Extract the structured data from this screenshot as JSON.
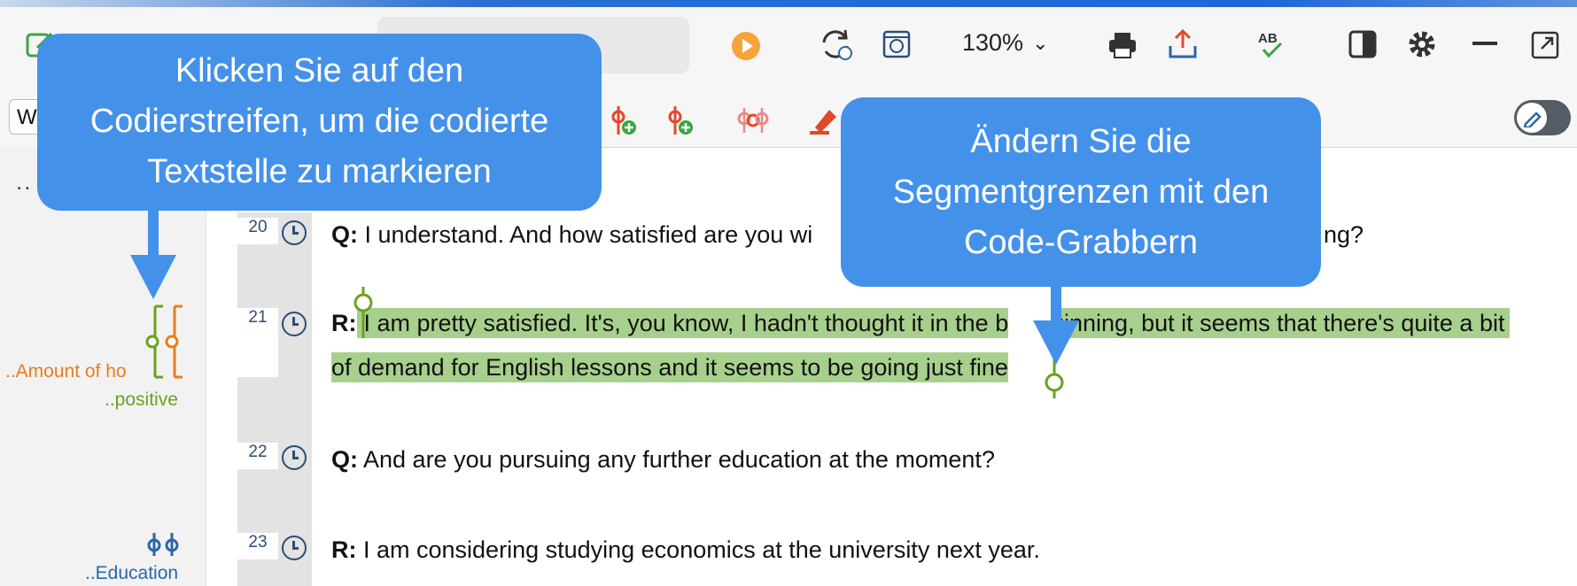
{
  "toolbar": {
    "zoom_value": "130%",
    "zoom_chevron": "⌄",
    "document_field_value": "W",
    "icons": [
      "edit-icon",
      "play-icon",
      "sync-time-icon",
      "timestamp-icon",
      "print-icon",
      "export-icon",
      "spellcheck-icon",
      "sidebar-icon",
      "gear-icon",
      "minimize-icon",
      "external-window-icon"
    ],
    "coding_icons": [
      "code-add-icon",
      "code-add-icon-2",
      "code-multi-icon",
      "highlighter-icon",
      "edit-mode-toggle"
    ]
  },
  "margin": {
    "dots": "..",
    "codes": [
      {
        "label": "..Amount of ho",
        "color": "#e87d1e"
      },
      {
        "label": "..positive",
        "color": "#6aa121"
      },
      {
        "label": "..Education",
        "color": "#2b67a8"
      }
    ]
  },
  "paragraphs": [
    {
      "num": "20",
      "speaker": "Q:",
      "text": " I understand. And how satisfied are you wi",
      "tail": "ng?"
    },
    {
      "num": "21",
      "speaker": "R:",
      "text": "I am pretty satisfied. It's, you know, I hadn't thought it in the b",
      "text_b": "ginning, but it seems that there's quite a bit",
      "line2": "of demand for English lessons and it seems to be going just fine"
    },
    {
      "num": "22",
      "speaker": "Q:",
      "text": " And are you pursuing any further education at the moment?"
    },
    {
      "num": "23",
      "speaker": "R:",
      "text": " I am considering studying economics at the university next year."
    }
  ],
  "callouts": {
    "left": "Klicken Sie auf den Codierstreifen, um die codierte Textstelle zu markieren",
    "left_lines": [
      "Klicken Sie auf den",
      "Codierstreifen, um die codierte",
      "Textstelle zu markieren"
    ],
    "right_lines": [
      "Ändern Sie die",
      "Segmentgrenzen mit den",
      "Code-Grabbern"
    ]
  },
  "colors": {
    "accent": "#4491ea",
    "highlight": "#a8d08d",
    "code_orange": "#e87d1e",
    "code_green": "#6aa121",
    "code_blue": "#2b67a8"
  }
}
